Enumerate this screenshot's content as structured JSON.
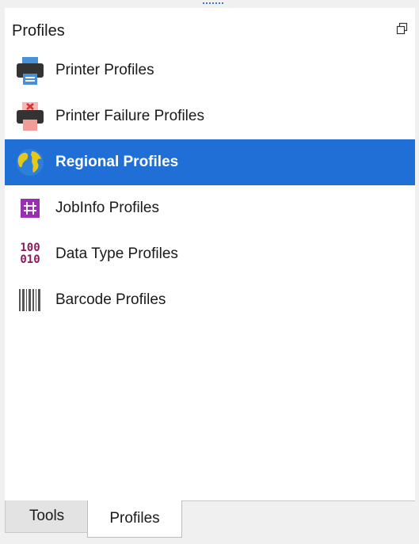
{
  "panel": {
    "title": "Profiles"
  },
  "items": [
    {
      "label": "Printer Profiles",
      "icon": "printer-icon"
    },
    {
      "label": "Printer Failure Profiles",
      "icon": "printer-failure-icon"
    },
    {
      "label": "Regional Profiles",
      "icon": "globe-icon",
      "selected": true
    },
    {
      "label": "JobInfo Profiles",
      "icon": "hash-icon"
    },
    {
      "label": "Data Type Profiles",
      "icon": "binary-data-icon",
      "icon_text_top": "100",
      "icon_text_bottom": "010"
    },
    {
      "label": "Barcode Profiles",
      "icon": "barcode-icon"
    }
  ],
  "tabs": [
    {
      "label": "Tools",
      "active": false
    },
    {
      "label": "Profiles",
      "active": true
    }
  ],
  "colors": {
    "selection": "#1f6fd6",
    "hash_purple": "#9b2fb3",
    "binary_maroon": "#8b1a5a"
  }
}
